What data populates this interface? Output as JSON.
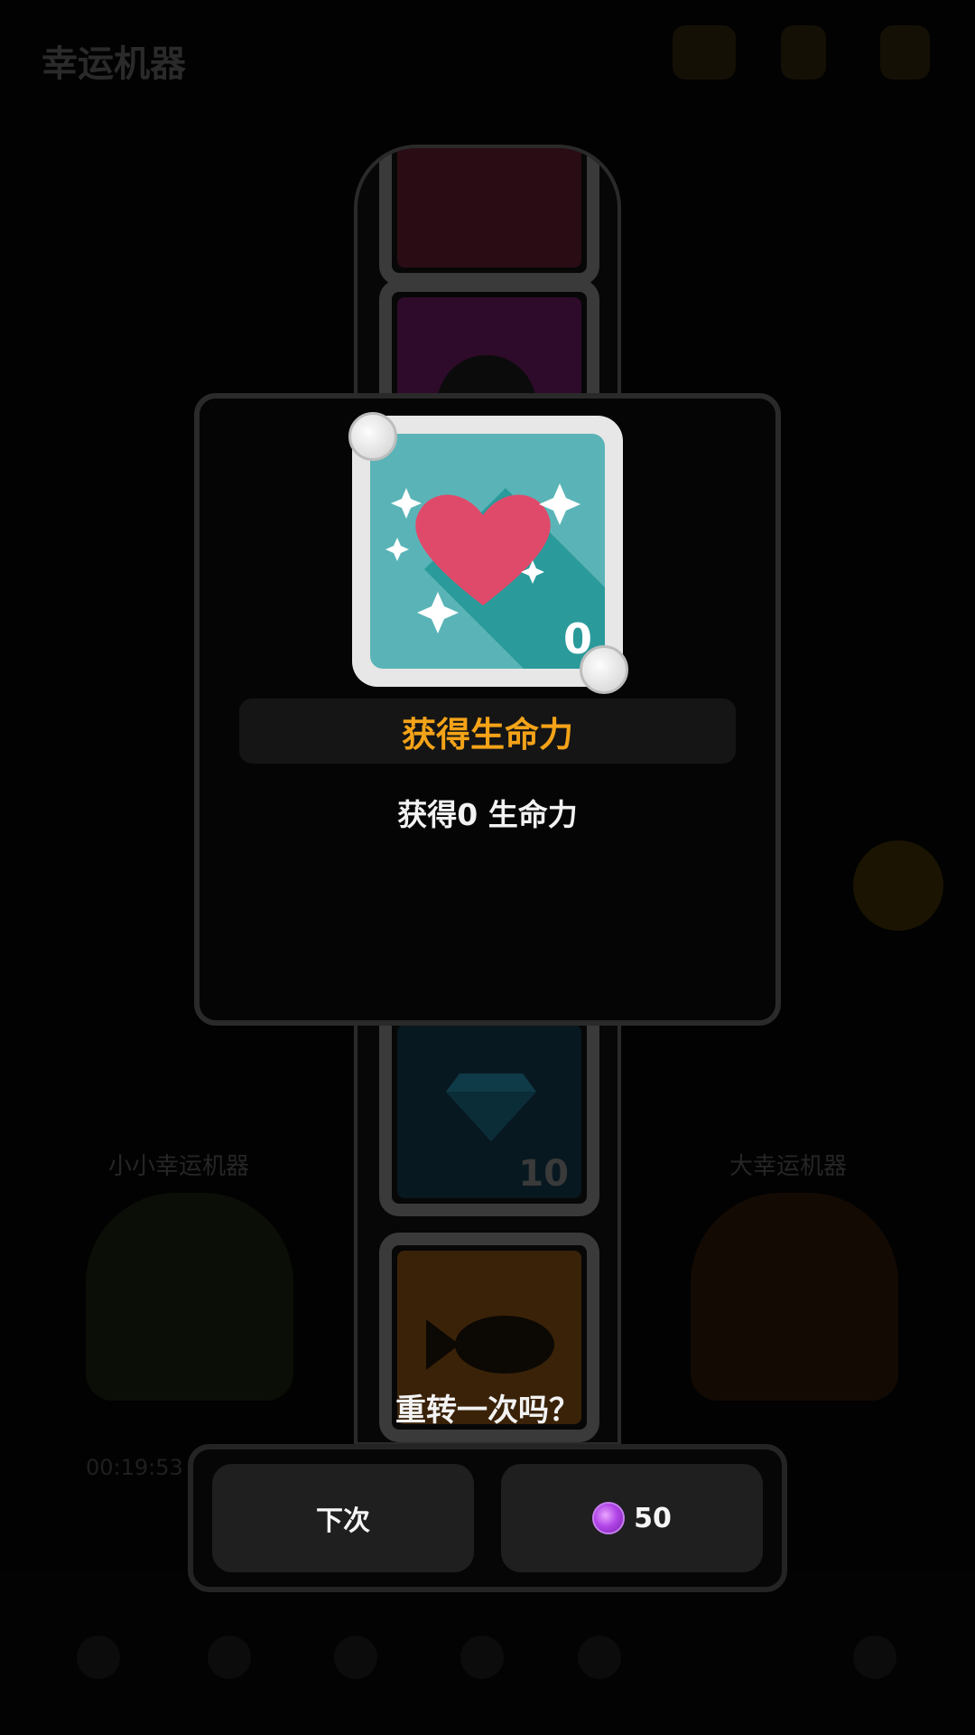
{
  "background": {
    "title": "幸运机器",
    "left_machine_label": "小小幸运机器",
    "right_machine_label": "大幸运机器",
    "left_timer": "00:19:53"
  },
  "reel": {
    "gem_tile_count": "10"
  },
  "reward_card": {
    "icon": "heart-sparkle-icon",
    "count": "0",
    "background_color": "#5ab4b7",
    "heart_color": "#e04a6a"
  },
  "reward": {
    "title": "获得生命力",
    "description": "获得0 生命力",
    "title_color": "#f4a318"
  },
  "respin": {
    "prompt": "重转一次吗？",
    "next_label": "下次",
    "cost": "50",
    "cost_icon": "purple-gem-icon"
  }
}
